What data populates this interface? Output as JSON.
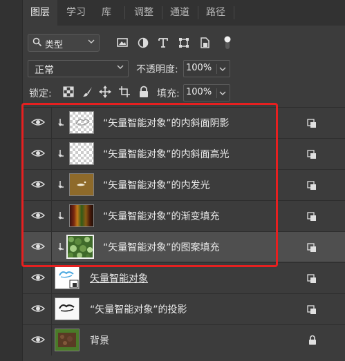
{
  "tabs": [
    "图层",
    "学习",
    "库",
    "调整",
    "通道",
    "路径"
  ],
  "filter": {
    "label": "类型"
  },
  "blend": {
    "mode": "正常",
    "opacity_label": "不透明度:",
    "opacity_value": "100%"
  },
  "lock": {
    "label": "锁定:",
    "fill_label": "填充:",
    "fill_value": "100%"
  },
  "layers": [
    {
      "name": "“矢量智能对象”的内斜面阴影",
      "thumb": "checker-inner-shadow",
      "selected": false
    },
    {
      "name": "“矢量智能对象”的内斜面高光",
      "thumb": "checker",
      "selected": false
    },
    {
      "name": "“矢量智能对象”的内发光",
      "thumb": "gold",
      "selected": false
    },
    {
      "name": "“矢量智能对象”的渐变填充",
      "thumb": "gradient",
      "selected": false
    },
    {
      "name": "“矢量智能对象”的图案填充",
      "thumb": "pattern",
      "selected": true
    },
    {
      "name": "矢量智能对象",
      "thumb": "smart-object",
      "selected": false
    },
    {
      "name": "“矢量智能对象”的投影",
      "thumb": "text-logo",
      "selected": false
    },
    {
      "name": "背景",
      "thumb": "grass",
      "selected": false
    }
  ],
  "colors": {
    "panel": "#3c3c3c",
    "selected_row": "#4f4f4f",
    "highlight_box": "#e62020"
  }
}
